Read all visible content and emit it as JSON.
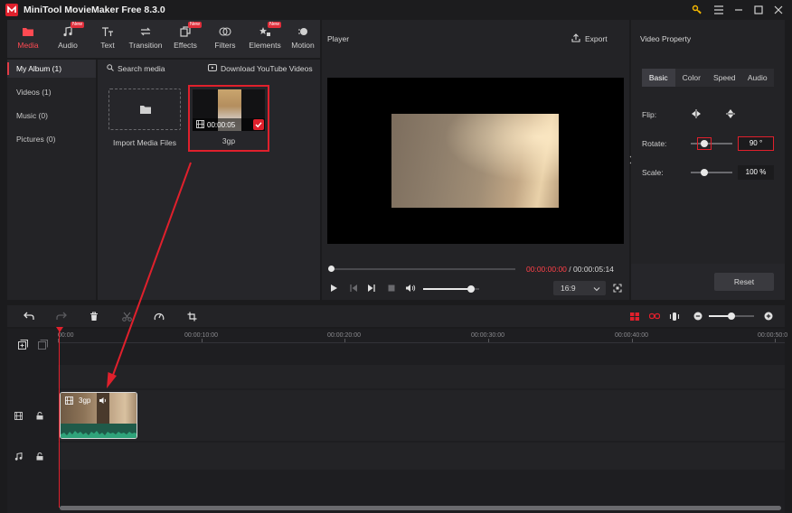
{
  "app": {
    "title": "MiniTool MovieMaker Free 8.3.0"
  },
  "toolbar": {
    "tabs": [
      {
        "label": "Media",
        "icon": "folder-icon",
        "active": true,
        "badge": ""
      },
      {
        "label": "Audio",
        "icon": "music-note-icon",
        "active": false,
        "badge": "New"
      },
      {
        "label": "Text",
        "icon": "text-icon",
        "active": false,
        "badge": ""
      },
      {
        "label": "Transition",
        "icon": "transition-icon",
        "active": false,
        "badge": ""
      },
      {
        "label": "Effects",
        "icon": "effects-icon",
        "active": false,
        "badge": "New"
      },
      {
        "label": "Filters",
        "icon": "filters-icon",
        "active": false,
        "badge": ""
      },
      {
        "label": "Elements",
        "icon": "elements-icon",
        "active": false,
        "badge": "New"
      },
      {
        "label": "Motion",
        "icon": "motion-icon",
        "active": false,
        "badge": ""
      }
    ]
  },
  "sidebar": {
    "items": [
      {
        "label": "My Album (1)",
        "active": true
      },
      {
        "label": "Videos (1)",
        "active": false
      },
      {
        "label": "Music (0)",
        "active": false
      },
      {
        "label": "Pictures (0)",
        "active": false
      }
    ]
  },
  "media": {
    "search_label": "Search media",
    "download_label": "Download YouTube Videos",
    "import_label": "Import Media Files",
    "clip": {
      "name": "3gp",
      "duration": "00:00:05",
      "selected": true
    }
  },
  "player": {
    "title": "Player",
    "export_label": "Export",
    "current_time": "00:00:00:00",
    "separator": " / ",
    "total_time": "00:00:05:14",
    "aspect": "16:9",
    "progress": 0.0,
    "volume": 0.85
  },
  "props": {
    "title": "Video Property",
    "tabs": [
      "Basic",
      "Color",
      "Speed",
      "Audio"
    ],
    "flip_label": "Flip:",
    "rotate_label": "Rotate:",
    "rotate_value": "90 °",
    "scale_label": "Scale:",
    "scale_value": "100 %",
    "reset_label": "Reset"
  },
  "timeline": {
    "ticks": [
      "00:00",
      "00:00:10:00",
      "00:00:20:00",
      "00:00:30:00",
      "00:00:40:00",
      "00:00:50:0"
    ],
    "clip_label": "3gp",
    "zoom": 0.5
  },
  "colors": {
    "accent": "#e0202c",
    "active_tab": "#ff4a52",
    "wave": "#1f5a49"
  }
}
